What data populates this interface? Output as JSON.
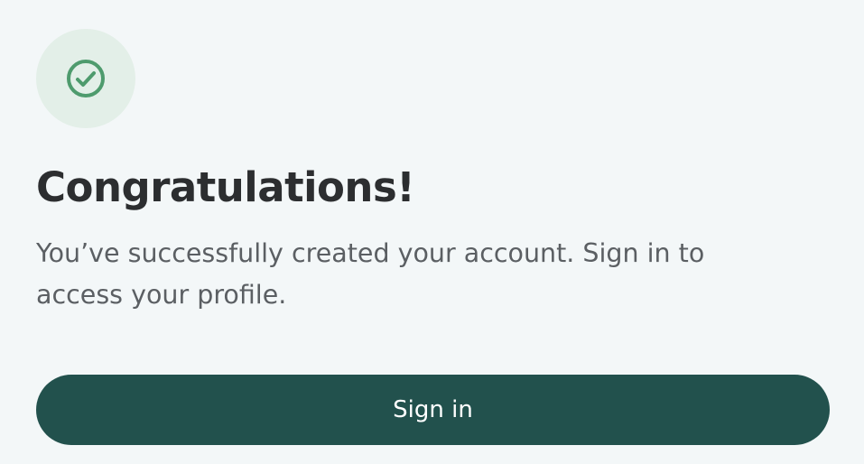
{
  "success": {
    "icon": "check-circle-icon",
    "title": "Congratulations!",
    "message": "You’ve successfully created your account. Sign in to access your profile.",
    "button_label": "Sign in"
  },
  "colors": {
    "background": "#f3f7f8",
    "icon_circle_bg": "#e3efe8",
    "icon_stroke": "#4e9b6d",
    "title_text": "#2c2e30",
    "body_text": "#5b5f63",
    "button_bg": "#22514d",
    "button_text": "#ffffff"
  }
}
